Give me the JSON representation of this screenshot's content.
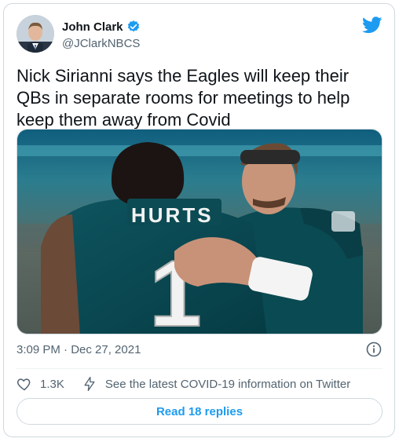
{
  "author": {
    "name": "John Clark",
    "handle": "@JClarkNBCS",
    "verified": true
  },
  "tweet": {
    "text": "Nick Sirianni says the Eagles will keep their QBs in separate rooms for meetings to help keep them away from Covid",
    "image_jersey_name": "HURTS",
    "image_jersey_number": "1",
    "timestamp": "3:09 PM · Dec 27, 2021"
  },
  "actions": {
    "likes_count": "1.3K",
    "covid_info": "See the latest COVID-19 information on Twitter"
  },
  "replies": {
    "label": "Read 18 replies"
  },
  "colors": {
    "twitter_blue": "#1d9bf0",
    "secondary_text": "#536471",
    "border": "#cfd9de",
    "eagles_green": "#004c54"
  },
  "icons": {
    "verified": "verified-badge-icon",
    "brand": "twitter-bird-icon",
    "info": "info-icon",
    "like": "heart-icon",
    "covid": "lightning-icon"
  }
}
